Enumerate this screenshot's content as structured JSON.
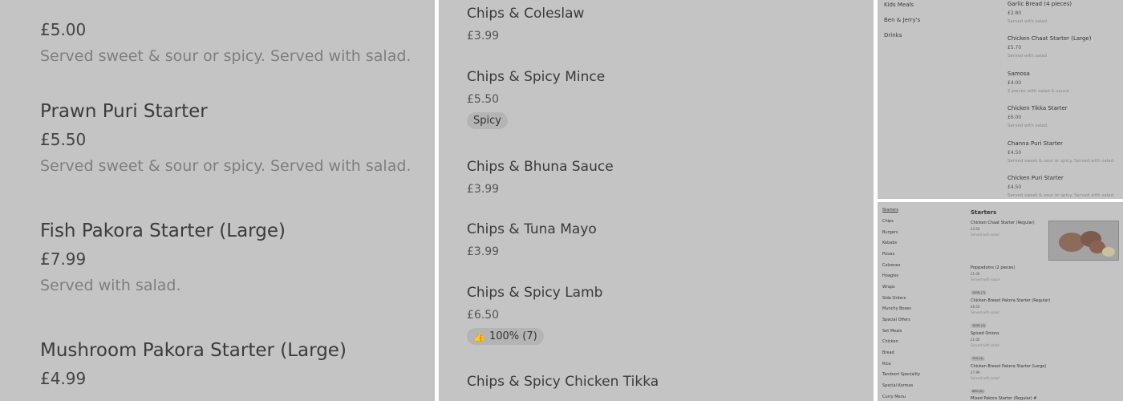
{
  "panel1": {
    "items": [
      {
        "price": "£5.00",
        "desc": "Served sweet & sour or spicy. Served with salad."
      },
      {
        "name": "Prawn Puri Starter",
        "price": "£5.50",
        "desc": "Served sweet & sour or spicy. Served with salad."
      },
      {
        "name": "Fish Pakora Starter (Large)",
        "price": "£7.99",
        "desc": "Served with salad."
      },
      {
        "name": "Mushroom Pakora Starter (Large)",
        "price": "£4.99"
      }
    ]
  },
  "panel2": {
    "items": [
      {
        "name": "Chips & Coleslaw",
        "price": "£3.99"
      },
      {
        "name": "Chips & Spicy Mince",
        "price": "£5.50",
        "badge": "Spicy"
      },
      {
        "name": "Chips & Bhuna Sauce",
        "price": "£3.99"
      },
      {
        "name": "Chips & Tuna Mayo",
        "price": "£3.99"
      },
      {
        "name": "Chips & Spicy Lamb",
        "price": "£6.50",
        "badge": "100% (7)"
      },
      {
        "name": "Chips & Spicy Chicken Tikka"
      }
    ]
  },
  "panel3": {
    "categories": [
      "Kids Meals",
      "Ben & Jerry's",
      "Drinks"
    ],
    "items": [
      {
        "name": "Garlic Bread (4 pieces)",
        "price": "£2.80",
        "desc": "Served with salad"
      },
      {
        "name": "Chicken Chaat Starter (Large)",
        "price": "£5.70",
        "desc": "Served with salad"
      },
      {
        "name": "Samosa",
        "price": "£4.00",
        "desc": "2 pieces with salad & sauce"
      },
      {
        "name": "Chicken Tikka Starter",
        "price": "£6.00",
        "desc": "Served with salad."
      },
      {
        "name": "Channa Puri Starter",
        "price": "£4.50",
        "desc": "Served sweet & sour or spicy. Served with salad."
      },
      {
        "name": "Chicken Puri Starter",
        "price": "£4.50",
        "desc": "Served sweet & sour or spicy. Served with salad."
      }
    ]
  },
  "panel4": {
    "title": "Starters",
    "categories": [
      "Starters",
      "Chips",
      "Burgers",
      "Kebabs",
      "Pizzas",
      "Calzones",
      "Hoagies",
      "Wraps",
      "Side Orders",
      "Munchy Boxes",
      "Special Offers",
      "Set Meals",
      "Chicken",
      "Bread",
      "Rice",
      "Tandoori Speciality",
      "Special Kormas",
      "Curry Menu"
    ],
    "items": [
      {
        "name": "Chicken Chaat Starter (Regular)",
        "price": "£4.50",
        "desc": "Served with salad"
      },
      {
        "name": "Poppadoms (2 pieces)",
        "price": "£1.00",
        "desc": "Served with sauce",
        "badge": "100% (7)"
      },
      {
        "name": "Chicken Breast Pakora Starter (Regular)",
        "price": "£6.50",
        "desc": "Served with salad",
        "badge": "100% (4)"
      },
      {
        "name": "Spiced Onions",
        "price": "£1.00",
        "desc": "Served with salad",
        "badge": "75% (4)"
      },
      {
        "name": "Chicken Breast Pakora Starter (Large)",
        "price": "£7.99",
        "desc": "Served with salad",
        "badge": "88% (8)"
      },
      {
        "name": "Mixed Pakora Starter (Regular) #"
      }
    ]
  },
  "colors": {
    "panel_bg": "#c4c4c4",
    "badge_bg": "#b4b4b4",
    "text": "#3a3a3a"
  }
}
